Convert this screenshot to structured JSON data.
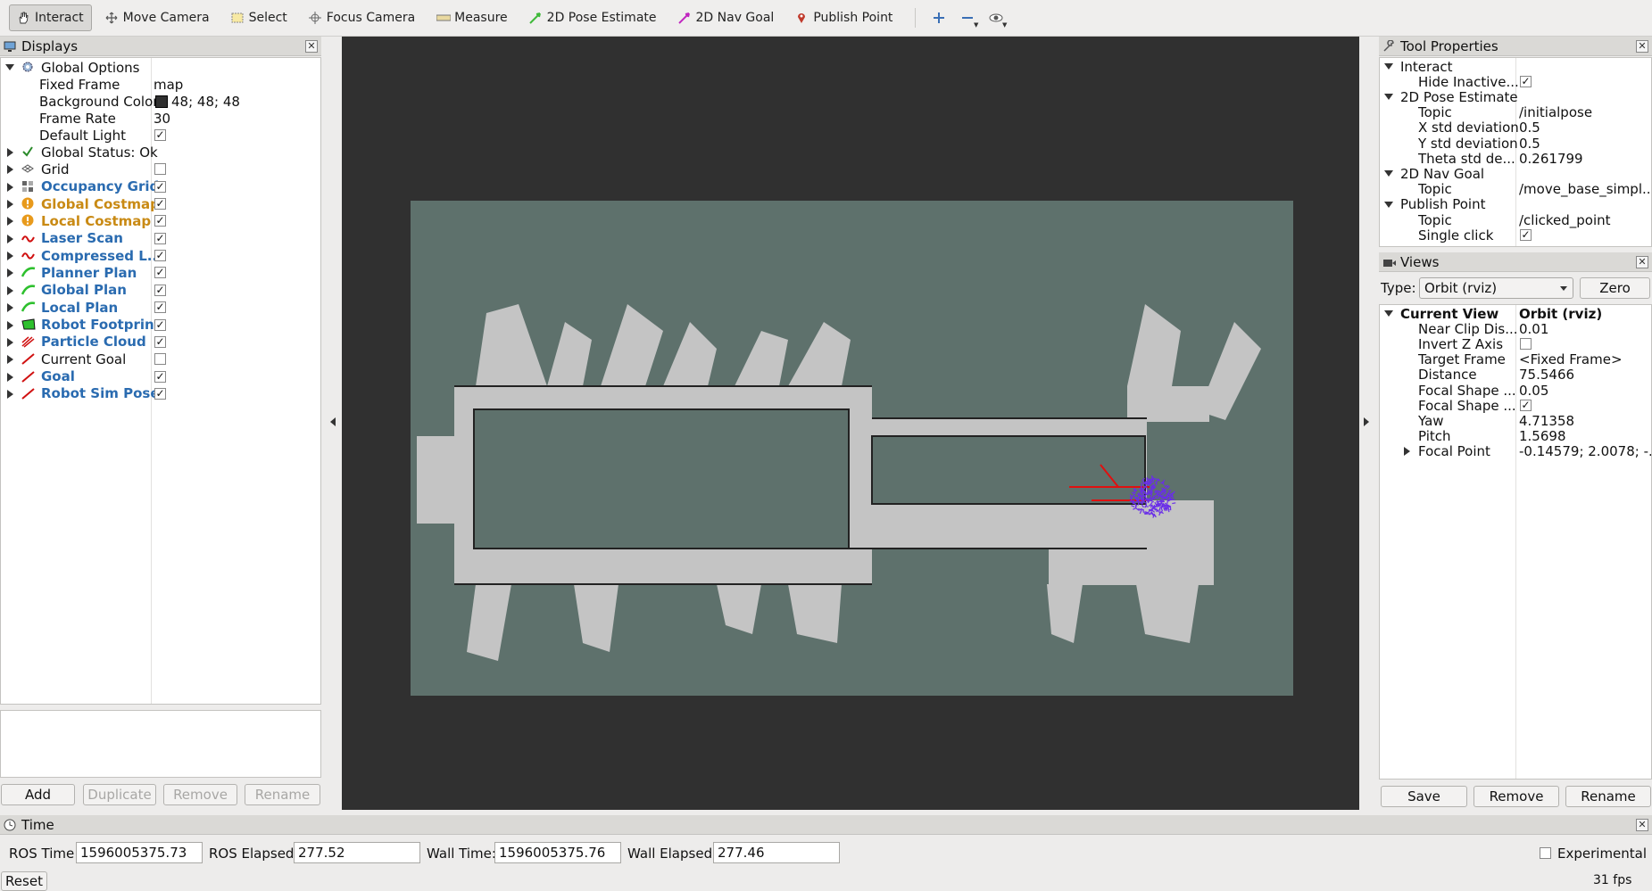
{
  "toolbar": {
    "tools": [
      {
        "label": "Interact",
        "icon": "hand-icon",
        "active": true
      },
      {
        "label": "Move Camera",
        "icon": "move-camera-icon"
      },
      {
        "label": "Select",
        "icon": "select-icon"
      },
      {
        "label": "Focus Camera",
        "icon": "focus-camera-icon"
      },
      {
        "label": "Measure",
        "icon": "ruler-icon"
      },
      {
        "label": "2D Pose Estimate",
        "icon": "green-arrow-icon"
      },
      {
        "label": "2D Nav Goal",
        "icon": "magenta-arrow-icon"
      },
      {
        "label": "Publish Point",
        "icon": "map-pin-icon"
      }
    ],
    "extra_icons": [
      "plus-icon",
      "minus-icon",
      "eye-icon"
    ]
  },
  "displays": {
    "title": "Displays",
    "global_options": {
      "label": "Global Options",
      "fixed_frame_label": "Fixed Frame",
      "fixed_frame_value": "map",
      "bg_color_label": "Background Color",
      "bg_color_value": "48; 48; 48",
      "bg_color_swatch": "#303030",
      "frame_rate_label": "Frame Rate",
      "frame_rate_value": "30",
      "default_light_label": "Default Light"
    },
    "items": [
      {
        "label": "Global Status: Ok",
        "style": "plain",
        "icon": "check-icon",
        "check": null
      },
      {
        "label": "Grid",
        "style": "plain",
        "icon": "grid-icon",
        "check": false
      },
      {
        "label": "Occupancy Grid",
        "style": "blue",
        "icon": "map-icon",
        "check": true
      },
      {
        "label": "Global Costmap",
        "style": "orange",
        "icon": "warning-icon",
        "check": true
      },
      {
        "label": "Local Costmap",
        "style": "orange",
        "icon": "warning-icon",
        "check": true
      },
      {
        "label": "Laser Scan",
        "style": "blue",
        "icon": "laser-scan-icon",
        "check": true
      },
      {
        "label": "Compressed L...",
        "style": "blue",
        "icon": "laser-scan-icon",
        "check": true
      },
      {
        "label": "Planner Plan",
        "style": "blue",
        "icon": "path-icon",
        "check": true
      },
      {
        "label": "Global Plan",
        "style": "blue",
        "icon": "path-icon",
        "check": true
      },
      {
        "label": "Local Plan",
        "style": "blue",
        "icon": "path-icon",
        "check": true
      },
      {
        "label": "Robot Footprint",
        "style": "blue",
        "icon": "polygon-icon",
        "check": true
      },
      {
        "label": "Particle Cloud",
        "style": "blue",
        "icon": "pose-array-icon",
        "check": true
      },
      {
        "label": "Current Goal",
        "style": "plain",
        "icon": "pose-icon",
        "check": false
      },
      {
        "label": "Goal",
        "style": "blue",
        "icon": "pose-icon",
        "check": true
      },
      {
        "label": "Robot Sim Pose",
        "style": "blue",
        "icon": "pose-icon",
        "check": true
      }
    ],
    "buttons": {
      "add": "Add",
      "duplicate": "Duplicate",
      "remove": "Remove",
      "rename": "Rename"
    }
  },
  "tool_properties": {
    "title": "Tool Properties",
    "rows": [
      {
        "indent": 0,
        "label": "Interact",
        "value": "",
        "expander": "down"
      },
      {
        "indent": 1,
        "label": "Hide Inactive...",
        "value": "",
        "check": true
      },
      {
        "indent": 0,
        "label": "2D Pose Estimate",
        "value": "",
        "expander": "down"
      },
      {
        "indent": 1,
        "label": "Topic",
        "value": "/initialpose"
      },
      {
        "indent": 1,
        "label": "X std deviation",
        "value": "0.5"
      },
      {
        "indent": 1,
        "label": "Y std deviation",
        "value": "0.5"
      },
      {
        "indent": 1,
        "label": "Theta std de...",
        "value": "0.261799"
      },
      {
        "indent": 0,
        "label": "2D Nav Goal",
        "value": "",
        "expander": "down"
      },
      {
        "indent": 1,
        "label": "Topic",
        "value": "/move_base_simpl..."
      },
      {
        "indent": 0,
        "label": "Publish Point",
        "value": "",
        "expander": "down"
      },
      {
        "indent": 1,
        "label": "Topic",
        "value": "/clicked_point"
      },
      {
        "indent": 1,
        "label": "Single click",
        "value": "",
        "check": true
      }
    ]
  },
  "views": {
    "title": "Views",
    "type_label": "Type:",
    "type_value": "Orbit (rviz)",
    "zero_label": "Zero",
    "rows": [
      {
        "indent": 0,
        "label": "Current View",
        "value": "Orbit (rviz)",
        "expander": "down",
        "bold": true
      },
      {
        "indent": 1,
        "label": "Near Clip Dis...",
        "value": "0.01"
      },
      {
        "indent": 1,
        "label": "Invert Z Axis",
        "value": "",
        "check": false
      },
      {
        "indent": 1,
        "label": "Target Frame",
        "value": "<Fixed Frame>"
      },
      {
        "indent": 1,
        "label": "Distance",
        "value": "75.5466"
      },
      {
        "indent": 1,
        "label": "Focal Shape ...",
        "value": "0.05"
      },
      {
        "indent": 1,
        "label": "Focal Shape ...",
        "value": "",
        "check": true
      },
      {
        "indent": 1,
        "label": "Yaw",
        "value": "4.71358"
      },
      {
        "indent": 1,
        "label": "Pitch",
        "value": "1.5698"
      },
      {
        "indent": 1,
        "label": "Focal Point",
        "value": "-0.14579; 2.0078; -...",
        "expander": "right"
      }
    ],
    "buttons": {
      "save": "Save",
      "remove": "Remove",
      "rename": "Rename"
    }
  },
  "time": {
    "title": "Time",
    "ros_time_label": "ROS Time:",
    "ros_time_value": "1596005375.73",
    "ros_elapsed_label": "ROS Elapsed:",
    "ros_elapsed_value": "277.52",
    "wall_time_label": "Wall Time:",
    "wall_time_value": "1596005375.76",
    "wall_elapsed_label": "Wall Elapsed:",
    "wall_elapsed_value": "277.46",
    "experimental_label": "Experimental",
    "reset_label": "Reset",
    "fps": "31 fps"
  },
  "colors": {
    "viewport_bg": "#303030",
    "map_unknown": "#5e716c",
    "map_free": "#c4c4c4",
    "laser": "#e01010",
    "particles": "#6a2ee8",
    "blue_text": "#2a6bb0",
    "orange_text": "#c98a14"
  }
}
